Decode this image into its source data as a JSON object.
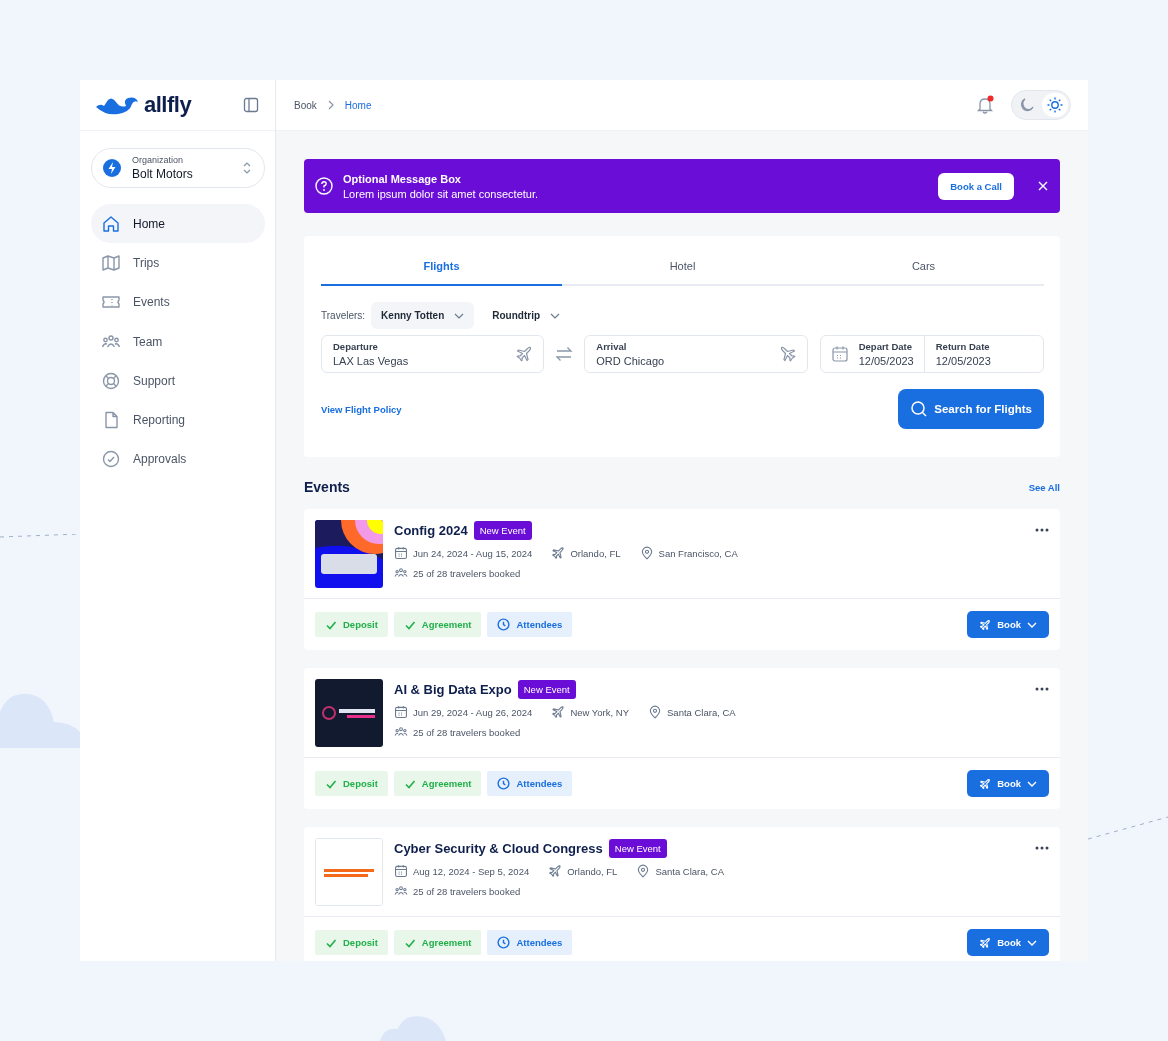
{
  "brand": {
    "name": "allfly"
  },
  "organization": {
    "label": "Organization",
    "name": "Bolt Motors"
  },
  "sidebar": {
    "items": [
      {
        "label": "Home",
        "selected": true
      },
      {
        "label": "Trips",
        "selected": false
      },
      {
        "label": "Events",
        "selected": false
      },
      {
        "label": "Team",
        "selected": false
      },
      {
        "label": "Support",
        "selected": false
      },
      {
        "label": "Reporting",
        "selected": false
      },
      {
        "label": "Approvals",
        "selected": false
      }
    ]
  },
  "breadcrumb": [
    {
      "label": "Book",
      "selected": false
    },
    {
      "label": "Home",
      "selected": true
    }
  ],
  "header": {
    "notification_dot": true,
    "theme_toggle": [
      {
        "selected": false
      },
      {
        "selected": true
      }
    ]
  },
  "message": {
    "title": "Optional Message Box",
    "body": "Lorem ipsum dolor sit amet consectetur.",
    "button": "Book a Call"
  },
  "search": {
    "tabs": [
      {
        "label": "Flights",
        "selected": true
      },
      {
        "label": "Hotel",
        "selected": false
      },
      {
        "label": "Cars",
        "selected": false
      }
    ],
    "travelers_label": "Travelers:",
    "traveler": "Kenny Totten",
    "trip_type": "Roundtrip",
    "departure": {
      "label": "Departure",
      "value": "LAX Las Vegas"
    },
    "arrival": {
      "label": "Arrival",
      "value": "ORD Chicago"
    },
    "depart_date": {
      "label": "Depart Date",
      "value": "12/05/2023"
    },
    "return_date": {
      "label": "Return Date",
      "value": "12/05/2023"
    },
    "policy_link": "View Flight Policy",
    "button": "Search for Flights"
  },
  "events": {
    "title": "Events",
    "see_all": "See All",
    "items": [
      {
        "name": "Config 2024",
        "badge": "New Event",
        "dates": "Jun 24, 2024 - Aug 15, 2024",
        "from": "Orlando, FL",
        "venue": "San Francisco, CA",
        "booked": "25 of 28 travelers booked",
        "tags": [
          {
            "label": "Deposit",
            "kind": "done"
          },
          {
            "label": "Agreement",
            "kind": "done"
          },
          {
            "label": "Attendees",
            "kind": "pending"
          }
        ],
        "button": "Book"
      },
      {
        "name": "AI & Big Data Expo",
        "badge": "New Event",
        "dates": "Jun 29, 2024 - Aug 26, 2024",
        "from": "New York, NY",
        "venue": "Santa Clara, CA",
        "booked": "25 of 28 travelers booked",
        "tags": [
          {
            "label": "Deposit",
            "kind": "done"
          },
          {
            "label": "Agreement",
            "kind": "done"
          },
          {
            "label": "Attendees",
            "kind": "pending"
          }
        ],
        "button": "Book"
      },
      {
        "name": "Cyber Security & Cloud Congress",
        "badge": "New Event",
        "dates": "Aug 12, 2024 - Sep 5, 2024",
        "from": "Orlando, FL",
        "venue": "Santa Clara, CA",
        "booked": "25 of 28 travelers booked",
        "tags": [
          {
            "label": "Deposit",
            "kind": "done"
          },
          {
            "label": "Agreement",
            "kind": "done"
          },
          {
            "label": "Attendees",
            "kind": "pending"
          }
        ],
        "button": "Book"
      }
    ]
  }
}
